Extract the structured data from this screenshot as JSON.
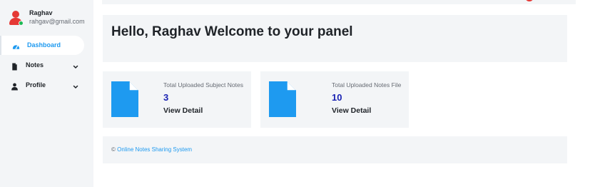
{
  "sidebar": {
    "user": {
      "name": "Raghav",
      "email": "rahgav@gmail.com"
    },
    "items": [
      {
        "label": "Dashboard",
        "icon": "dashboard-gauge-icon",
        "active": true
      },
      {
        "label": "Notes",
        "icon": "file-icon",
        "has_submenu": true
      },
      {
        "label": "Profile",
        "icon": "user-icon",
        "has_submenu": true
      }
    ]
  },
  "main": {
    "welcome_text": "Hello, Raghav Welcome to your panel",
    "cards": [
      {
        "title": "Total Uploaded Subject Notes",
        "count": "3",
        "link": "View Detail",
        "icon": "document-icon"
      },
      {
        "title": "Total Uploaded Notes File",
        "count": "10",
        "link": "View Detail",
        "icon": "document-icon"
      }
    ],
    "footer": {
      "copyright_symbol": "©",
      "link_text": "Online Notes Sharing System"
    }
  },
  "colors": {
    "accent": "#1e9af0",
    "count": "#1a23b3",
    "panel_bg": "#f3f5f7",
    "avatar": "#e53935",
    "online": "#1db954"
  }
}
